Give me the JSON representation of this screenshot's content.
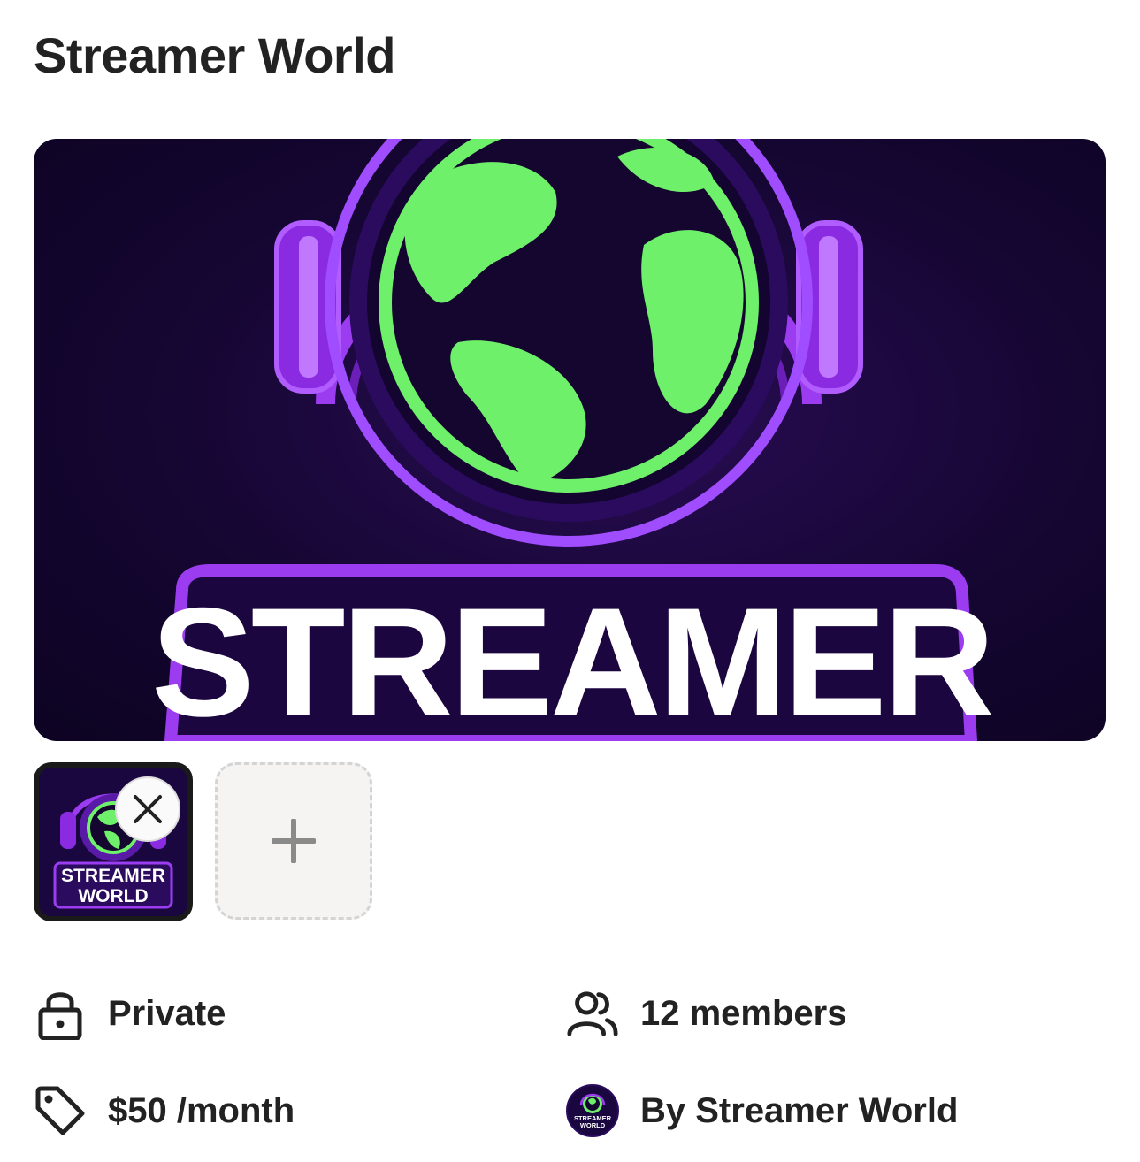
{
  "page": {
    "title": "Streamer World"
  },
  "cover_image": {
    "alt_icon": "streamer-world-logo",
    "logo_text": "STREAMER",
    "colors": {
      "background": "#150632",
      "purple": "#9b3cf0",
      "green": "#6ef06a",
      "text": "#ffffff"
    }
  },
  "thumbnails": [
    {
      "line1": "STREAMER",
      "line2": "WORLD",
      "remove_icon": "close-icon"
    }
  ],
  "add_media": {
    "icon": "plus-icon"
  },
  "details": {
    "privacy": {
      "icon": "lock-icon",
      "label": "Private"
    },
    "members": {
      "icon": "users-icon",
      "label": "12 members"
    },
    "price": {
      "icon": "tag-icon",
      "label": "$50 /month"
    },
    "owner": {
      "icon": "avatar",
      "label": "By Streamer World",
      "avatar_line1": "STREAMER",
      "avatar_line2": "WORLD"
    }
  }
}
